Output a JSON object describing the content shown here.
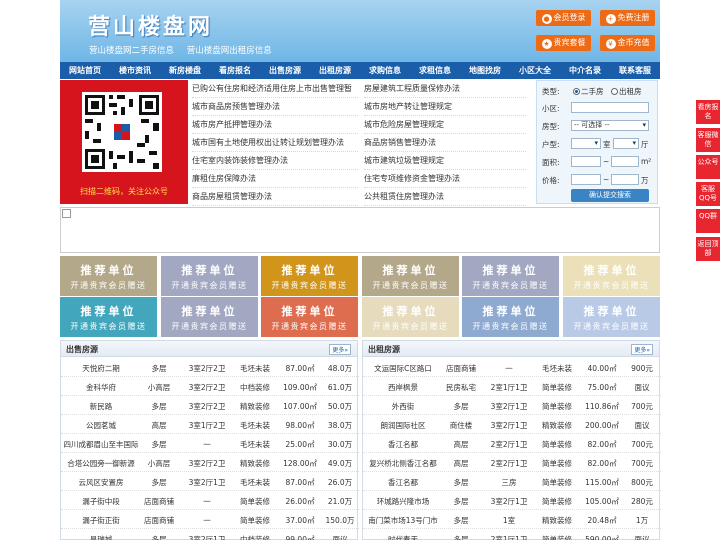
{
  "header": {
    "logo": "营山楼盘网",
    "slogans": [
      "营山楼盘网二手房信息",
      "营山楼盘网出租房信息"
    ],
    "buttons": [
      {
        "label": "会员登录",
        "icon": "user-icon"
      },
      {
        "label": "免费注册",
        "icon": "register-icon"
      },
      {
        "label": "贵宾套餐",
        "icon": "vip-icon"
      },
      {
        "label": "金币充值",
        "icon": "coin-icon"
      }
    ]
  },
  "nav": [
    "网站首页",
    "楼市资讯",
    "新房楼盘",
    "看房报名",
    "出售房源",
    "出租房源",
    "求购信息",
    "求租信息",
    "地图找房",
    "小区大全",
    "中介名录",
    "联系客服"
  ],
  "qr": {
    "caption": "扫描二维码，关注公众号"
  },
  "news": {
    "left": [
      "已购公有住房和经济适用住房上市出售管理暂",
      "城市商品房预售管理办法",
      "城市房产抵押管理办法",
      "城市国有土地使用权出让转让规划管理办法",
      "住宅室内装饰装修管理办法",
      "廉租住房保障办法",
      "商品房屋租赁管理办法"
    ],
    "right": [
      "房屋建筑工程质量保修办法",
      "城市房地产转让管理规定",
      "城市危险房屋管理规定",
      "商品房销售管理办法",
      "城市建筑垃圾管理规定",
      "住宅专项维修资金管理办法",
      "公共租赁住房管理办法"
    ]
  },
  "search": {
    "type_label": "类型:",
    "option_sale": "二手房",
    "option_rent": "出租房",
    "selected_option": "二手房",
    "community_label": "小区:",
    "community_value": "",
    "rooms_label": "房型:",
    "rooms_value": "-- 可选择 --",
    "layout_label": "户型:",
    "layout_room_unit": "室",
    "layout_hall_unit": "厅",
    "area_label": "面积:",
    "area_sep": "~",
    "area_unit": "m²",
    "price_label": "价格:",
    "price_sep": "~",
    "price_unit": "万",
    "submit": "确认提交搜索"
  },
  "tiles": {
    "line1": "推荐单位",
    "line2": "开通贵宾会员赠送",
    "colors": [
      "#b3a98a",
      "#a3a8c2",
      "#d1951b",
      "#b3a98a",
      "#a3a8c2",
      "#ebe0b8",
      "#42a7bd",
      "#a3a8c2",
      "#de6c4e",
      "#e6dcbd",
      "#8faad1",
      "#b9cae6"
    ]
  },
  "sale": {
    "title": "出售房源",
    "more": "更多»",
    "rows": [
      [
        "天悦府二期",
        "多层",
        "3室2厅2卫",
        "毛坯未装",
        "87.00㎡",
        "48.0万"
      ],
      [
        "金科华府",
        "小高层",
        "3室2厅2卫",
        "中档装修",
        "109.00㎡",
        "61.0万"
      ],
      [
        "新民路",
        "多层",
        "3室2厅2卫",
        "精致装修",
        "107.00㎡",
        "50.0万"
      ],
      [
        "公园茗城",
        "高层",
        "3室1厅2卫",
        "毛坯未装",
        "98.00㎡",
        "38.0万"
      ],
      [
        "四川成都眉山至丰国际",
        "多层",
        "一",
        "毛坯未装",
        "25.00㎡",
        "30.0万"
      ],
      [
        "合塔公园旁一御新源",
        "小高层",
        "3室2厅2卫",
        "精致装修",
        "128.00㎡",
        "49.0万"
      ],
      [
        "云风区安置房",
        "多层",
        "3室2厅1卫",
        "毛坯未装",
        "87.00㎡",
        "26.0万"
      ],
      [
        "漏子街中段",
        "店面商铺",
        "一",
        "简单装修",
        "26.00㎡",
        "21.0万"
      ],
      [
        "漏子街正街",
        "店面商铺",
        "一",
        "简单装修",
        "37.00㎡",
        "150.0万"
      ],
      [
        "昌瑞城",
        "多层",
        "3室2厅1卫",
        "中档装修",
        "99.00㎡",
        "面议"
      ]
    ]
  },
  "rent": {
    "title": "出租房源",
    "more": "更多»",
    "rows": [
      [
        "文运国际C区路口",
        "店面商铺",
        "一",
        "毛坯未装",
        "40.00㎡",
        "900元"
      ],
      [
        "西岸枫景",
        "民房私宅",
        "2室1厅1卫",
        "简单装修",
        "75.00㎡",
        "面议"
      ],
      [
        "外西街",
        "多层",
        "3室2厅1卫",
        "简单装修",
        "110.86㎡",
        "700元"
      ],
      [
        "朗润国际社区",
        "商住楼",
        "3室2厅1卫",
        "精致装修",
        "200.00㎡",
        "面议"
      ],
      [
        "香江名都",
        "高层",
        "2室2厅1卫",
        "简单装修",
        "82.00㎡",
        "700元"
      ],
      [
        "复兴桥北侧香江名都",
        "高层",
        "2室2厅1卫",
        "简单装修",
        "82.00㎡",
        "700元"
      ],
      [
        "香江名都",
        "多层",
        "三房",
        "简单装修",
        "115.00㎡",
        "800元"
      ],
      [
        "环城路兴隆市场",
        "多层",
        "3室2厅1卫",
        "简单装修",
        "105.00㎡",
        "280元"
      ],
      [
        "南门菜市场13号门市",
        "多层",
        "1室",
        "精致装修",
        "20.48㎡",
        "1万"
      ],
      [
        "时代春天",
        "多层",
        "2室1厅1卫",
        "简单装修",
        "590.00㎡",
        "面议"
      ]
    ]
  },
  "side": [
    "看房报名",
    "客服微信",
    "公众号",
    "客服QQ号",
    "QQ群",
    "返回顶部"
  ]
}
